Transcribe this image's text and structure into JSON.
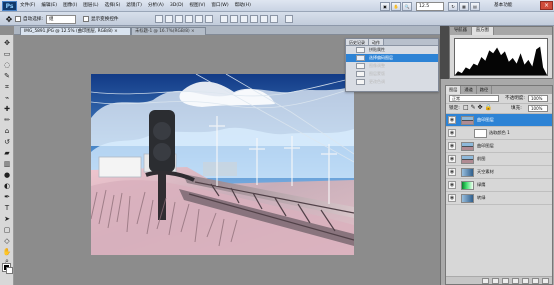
{
  "app": {
    "logo": "Ps",
    "menus": [
      "文件(F)",
      "编辑(E)",
      "图像(I)",
      "图层(L)",
      "选择(S)",
      "滤镜(T)",
      "分析(A)",
      "3D(D)",
      "视图(V)",
      "窗口(W)",
      "帮助(H)"
    ],
    "zoom": "12.5",
    "workspace": "基本功能",
    "close": "×"
  },
  "options": {
    "auto_select_label": "自动选择:",
    "auto_select_value": "组",
    "show_transform_label": "显示变换控件"
  },
  "tabs": [
    {
      "label": "IMG_5891.JPG @ 12.5% (曲印图层, RGB/8) ×"
    },
    {
      "label": "未标题-1 @ 16.7%(RGB/8) ×"
    }
  ],
  "history": {
    "tabs": [
      "历史记录",
      "动作"
    ],
    "items": [
      {
        "label": "拼贴属性",
        "state": "normal"
      },
      {
        "label": "选择偏码图层",
        "state": "selected"
      },
      {
        "label": "图像调整",
        "state": "disabled"
      },
      {
        "label": "图层蒙版",
        "state": "disabled"
      },
      {
        "label": "更改色调",
        "state": "disabled"
      }
    ]
  },
  "navigator": {
    "tabs": [
      "导航器",
      "直方图"
    ]
  },
  "layers": {
    "tabs": [
      "图层",
      "通道",
      "路径"
    ],
    "blend_mode": "正常",
    "opacity_label": "不透明度:",
    "opacity": "100%",
    "lock_label": "锁定:",
    "fill_label": "填充:",
    "fill": "100%",
    "items": [
      {
        "name": "曲印图层",
        "selected": true,
        "type": "photo"
      },
      {
        "name": "选取颜色 1",
        "selected": false,
        "type": "adjustment"
      },
      {
        "name": "曲印图层",
        "selected": false,
        "type": "photo"
      },
      {
        "name": "前图",
        "selected": false,
        "type": "photo"
      },
      {
        "name": "天空素材",
        "selected": false,
        "type": "sky"
      },
      {
        "name": "绿鹰",
        "selected": false,
        "type": "green"
      },
      {
        "name": "转绿",
        "selected": false,
        "type": "blue"
      }
    ]
  },
  "colors": {
    "accent": "#2d83d5",
    "panel": "#d7d7d7",
    "canvas": "#8c8c8c"
  }
}
